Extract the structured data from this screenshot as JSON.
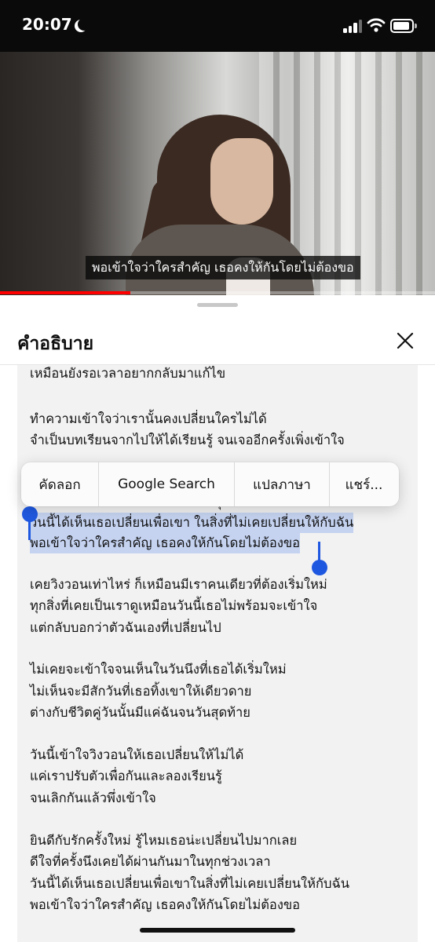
{
  "status_bar": {
    "time": "20:07",
    "icons": [
      "moon-icon",
      "cellular-signal-icon",
      "wifi-icon",
      "battery-icon"
    ]
  },
  "video": {
    "caption": "พอเข้าใจว่าใครสำคัญ เธอคงให้กันโดยไม่ต้องขอ",
    "progress_percent": 30
  },
  "sheet": {
    "title": "คำอธิบาย",
    "close_icon": "close-icon",
    "description_lines": [
      "เหมือนยังรอเวลาอยากกลับมาแก้ไข",
      "ทำความเข้าใจว่าเรานั้นคงเปลี่ยนใครไม่ได้",
      "จำเป็นบทเรียนจากไปให้ได้เรียนรู้ จนเจออีกครั้งเพิ่งเข้าใจ",
      "ดีใจที่ครั้งนึงเคย ได้ผ่านกันมา ในทุกช่วงเวลา",
      "วันนี้ได้เห็นเธอเปลี่ยนเพื่อเขา ในสิ่งที่ไม่เคยเปลี่ยนให้กับฉัน",
      "พอเข้าใจว่าใครสำคัญ เธอคงให้กันโดยไม่ต้องขอ",
      "เคยวิงวอนเท่าไหร่ ก็เหมือนมีเราคนเดียวที่ต้องเริ่มใหม่",
      "ทุกสิ่งที่เคยเป็นเราดูเหมือนวันนี้เธอไม่พร้อมจะเข้าใจ",
      "แต่กลับบอกว่าตัวฉันเองที่เปลี่ยนไป",
      "ไม่เคยจะเข้าใจจนเห็นในวันนึงที่เธอได้เริ่มใหม่",
      "ไม่เห็นจะมีสักวันที่เธอทิ้งเขาให้เดียวดาย",
      "ต่างกับชีวิตคู่วันนั้นมีแค่ฉันจนวันสุดท้าย",
      "วันนี้เข้าใจวิงวอนให้เธอเปลี่ยนให้ไม่ได้",
      "แค่เราปรับตัวเพื่อกันและลองเรียนรู้",
      "จนเลิกกันแล้วพึ่งเข้าใจ",
      "ยินดีกับรักครั้งใหม่ รู้ไหมเธอน่ะเปลี่ยนไปมากเลย",
      "ดีใจที่ครั้งนึงเคยได้ผ่านกันมาในทุกช่วงเวลา",
      "วันนี้ได้เห็นเธอเปลี่ยนเพื่อเขาในสิ่งที่ไม่เคยเปลี่ยนให้กับฉัน",
      "พอเข้าใจว่าใครสำคัญ เธอคงให้กันโดยไม่ต้องขอ"
    ]
  },
  "context_menu": {
    "items": [
      "คัดลอก",
      "Google Search",
      "แปลภาษา",
      "แชร์..."
    ]
  },
  "selection": {
    "color": "#c5d3f1",
    "handle_color": "#1f58e0"
  },
  "colors": {
    "progress": "#ff0000",
    "panel_bg": "#f2f2f2"
  }
}
